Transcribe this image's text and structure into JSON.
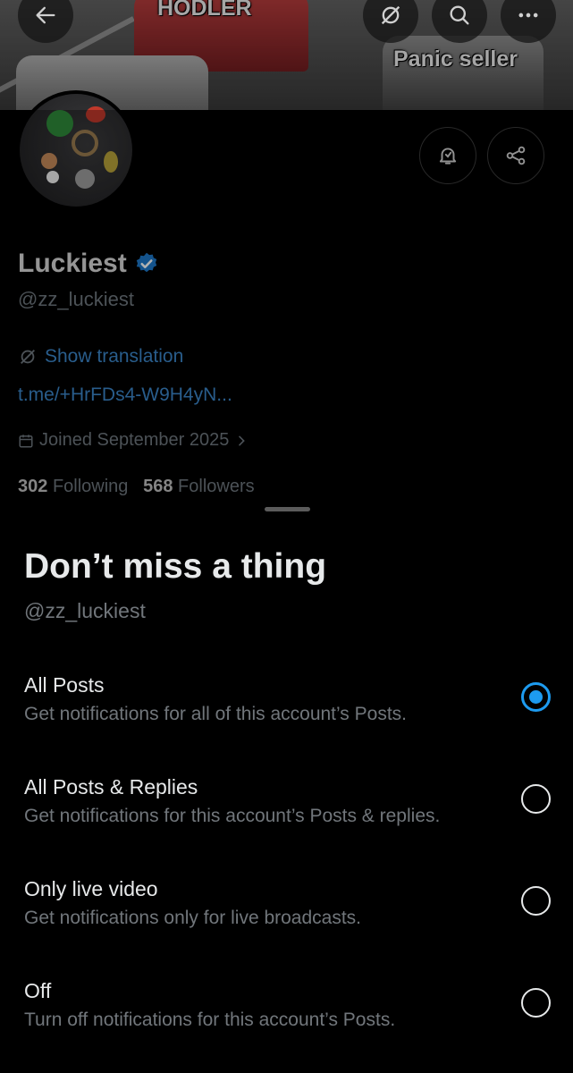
{
  "banner": {
    "meme_top": "HODLER",
    "meme_bottom": "Panic seller"
  },
  "profile": {
    "display_name": "Luckiest",
    "handle": "@zz_luckiest",
    "translate_label": "Show translation",
    "link": "t.me/+HrFDs4-W9H4yN...",
    "joined": "Joined September 2025",
    "following_count": "302",
    "following_label": "Following",
    "followers_count": "568",
    "followers_label": "Followers"
  },
  "sheet": {
    "title": "Don’t miss a thing",
    "handle": "@zz_luckiest",
    "options": [
      {
        "label": "All Posts",
        "description": "Get notifications for all of this account’s Posts.",
        "selected": true
      },
      {
        "label": "All Posts & Replies",
        "description": "Get notifications for this account’s Posts & replies.",
        "selected": false
      },
      {
        "label": "Only live video",
        "description": "Get notifications only for live broadcasts.",
        "selected": false
      },
      {
        "label": "Off",
        "description": "Turn off notifications for this account’s Posts.",
        "selected": false
      }
    ]
  },
  "colors": {
    "accent": "#1d9bf0",
    "link": "#3b86c9",
    "muted": "#71767b",
    "background": "#000000"
  },
  "icons": [
    "back-arrow-icon",
    "eye-slash-icon",
    "search-icon",
    "more-icon",
    "bell-check-icon",
    "share-icon",
    "verified-badge-icon",
    "translate-icon",
    "calendar-icon",
    "chevron-right-icon"
  ]
}
